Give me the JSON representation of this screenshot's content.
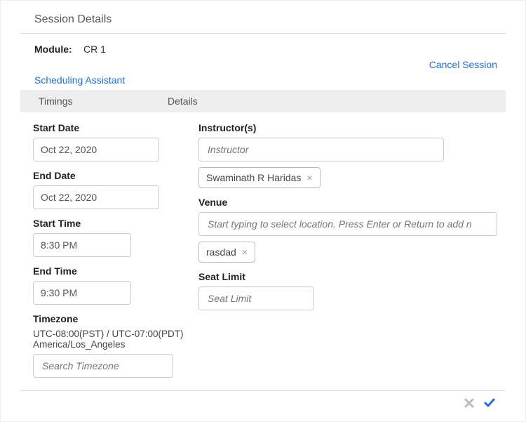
{
  "header": {
    "title": "Session Details"
  },
  "module": {
    "label": "Module:",
    "value": "CR 1"
  },
  "actions": {
    "cancel_session": "Cancel Session",
    "scheduling_assistant": "Scheduling Assistant"
  },
  "tabs": {
    "timings": "Timings",
    "details": "Details"
  },
  "timings": {
    "start_date_label": "Start Date",
    "start_date_value": "Oct 22, 2020",
    "end_date_label": "End Date",
    "end_date_value": "Oct 22, 2020",
    "start_time_label": "Start Time",
    "start_time_value": "8:30 PM",
    "end_time_label": "End Time",
    "end_time_value": "9:30 PM",
    "timezone_label": "Timezone",
    "timezone_value": "UTC-08:00(PST) / UTC-07:00(PDT) America/Los_Angeles",
    "timezone_placeholder": "Search Timezone"
  },
  "details": {
    "instructors_label": "Instructor(s)",
    "instructors_placeholder": "Instructor",
    "instructor_chips": [
      "Swaminath R Haridas"
    ],
    "venue_label": "Venue",
    "venue_placeholder": "Start typing to select location. Press Enter or Return to add n",
    "venue_chips": [
      "rasdad"
    ],
    "seat_limit_label": "Seat Limit",
    "seat_limit_placeholder": "Seat Limit"
  },
  "icons": {
    "remove": "×"
  }
}
